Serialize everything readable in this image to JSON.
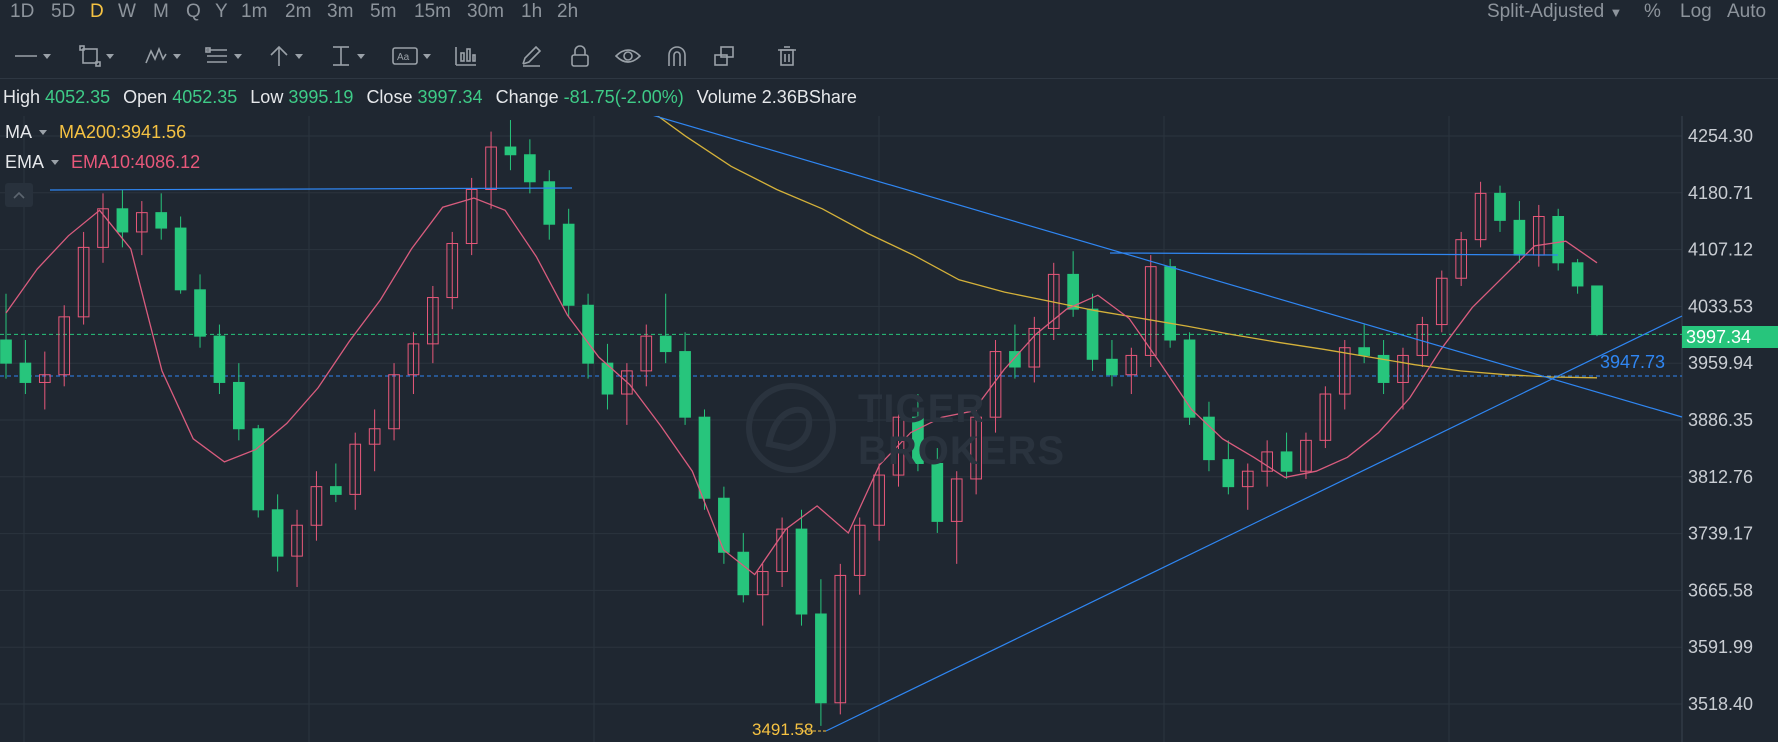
{
  "timeframes": [
    "1D",
    "5D",
    "D",
    "W",
    "M",
    "Q",
    "Y",
    "1m",
    "2m",
    "3m",
    "5m",
    "15m",
    "30m",
    "1h",
    "2h"
  ],
  "active_timeframe": "D",
  "right_options": {
    "adjust": "Split-Adjusted",
    "percent": "%",
    "log": "Log",
    "auto": "Auto"
  },
  "toolbar_icons": [
    "line-tool-icon",
    "rectangle-tool-icon",
    "pattern-tool-icon",
    "fib-tool-icon",
    "arrow-tool-icon",
    "measure-tool-icon",
    "text-tool-icon",
    "indicator-tool-icon",
    "pencil-icon",
    "lock-icon",
    "eye-icon",
    "magnet-icon",
    "copy-icon",
    "trash-icon"
  ],
  "ohlc": {
    "high_label": "High",
    "high": "4052.35",
    "open_label": "Open",
    "open": "4052.35",
    "low_label": "Low",
    "low": "3995.19",
    "close_label": "Close",
    "close": "3997.34",
    "change_label": "Change",
    "change": "-81.75(-2.00%)",
    "volume_label": "Volume",
    "volume": "2.36BShare"
  },
  "indicators": {
    "ma": {
      "name": "MA",
      "value": "MA200:3941.56",
      "color": "#f5c242"
    },
    "ema": {
      "name": "EMA",
      "value": "EMA10:4086.12",
      "color": "#e8587a"
    }
  },
  "watermark": {
    "line1": "TIGER",
    "line2": "BROKERS"
  },
  "last_price_tag": "3997.34",
  "line_price_tag": "3947.73",
  "low_marker": "3491.58",
  "colors": {
    "up": "#e8587a",
    "down": "#27c57c",
    "ma": "#d4b13a",
    "ema": "#d95c7e",
    "trend": "#2f86f2",
    "bg": "#1f2731",
    "grid": "#2b343e"
  },
  "chart_data": {
    "type": "candlestick",
    "y_ticks": [
      "4254.30",
      "4180.71",
      "4107.12",
      "4033.53",
      "3959.94",
      "3886.35",
      "3812.76",
      "3739.17",
      "3665.58",
      "3591.99",
      "3518.40"
    ],
    "ylim": [
      3490,
      4274
    ],
    "last_close": 3997.34,
    "series": [
      {
        "name": "MA200",
        "values": [
          4297,
          4254,
          4215,
          4185,
          4160,
          4128,
          4100,
          4068,
          4052,
          4040,
          4028,
          4018,
          4008,
          3997,
          3987,
          3978,
          3968,
          3958,
          3950,
          3945,
          3942,
          3941
        ]
      },
      {
        "name": "EMA10",
        "values": [
          4025,
          4082,
          4125,
          4158,
          4108,
          3950,
          3862,
          3832,
          3848,
          3882,
          3928,
          3988,
          4042,
          4108,
          4162,
          4174,
          4158,
          4098,
          4022,
          3968,
          3932,
          3878,
          3820,
          3718,
          3686,
          3745,
          3775,
          3740,
          3828,
          3870,
          3890,
          3898,
          3952,
          3997,
          4030,
          4048,
          4018,
          3960,
          3900,
          3862,
          3838,
          3812,
          3820,
          3838,
          3870,
          3915,
          3978,
          4032,
          4072,
          4112,
          4118,
          4090
        ]
      }
    ],
    "candles_ohlc": [
      [
        3990,
        4050,
        3940,
        3960
      ],
      [
        3960,
        3990,
        3920,
        3935
      ],
      [
        3935,
        3975,
        3900,
        3945
      ],
      [
        3945,
        4035,
        3930,
        4020
      ],
      [
        4020,
        4130,
        4010,
        4110
      ],
      [
        4110,
        4180,
        4090,
        4160
      ],
      [
        4160,
        4185,
        4110,
        4130
      ],
      [
        4130,
        4170,
        4100,
        4155
      ],
      [
        4155,
        4180,
        4120,
        4135
      ],
      [
        4135,
        4150,
        4050,
        4055
      ],
      [
        4055,
        4075,
        3980,
        3995
      ],
      [
        3995,
        4010,
        3920,
        3935
      ],
      [
        3935,
        3960,
        3860,
        3875
      ],
      [
        3875,
        3880,
        3760,
        3770
      ],
      [
        3770,
        3790,
        3690,
        3710
      ],
      [
        3710,
        3770,
        3670,
        3750
      ],
      [
        3750,
        3820,
        3730,
        3800
      ],
      [
        3800,
        3830,
        3780,
        3790
      ],
      [
        3790,
        3870,
        3770,
        3855
      ],
      [
        3855,
        3900,
        3820,
        3875
      ],
      [
        3875,
        3960,
        3860,
        3945
      ],
      [
        3945,
        4000,
        3920,
        3985
      ],
      [
        3985,
        4060,
        3960,
        4045
      ],
      [
        4045,
        4130,
        4030,
        4115
      ],
      [
        4115,
        4200,
        4100,
        4185
      ],
      [
        4185,
        4260,
        4160,
        4240
      ],
      [
        4240,
        4275,
        4210,
        4230
      ],
      [
        4230,
        4250,
        4180,
        4195
      ],
      [
        4195,
        4210,
        4120,
        4140
      ],
      [
        4140,
        4160,
        4020,
        4035
      ],
      [
        4035,
        4050,
        3940,
        3960
      ],
      [
        3960,
        3985,
        3900,
        3920
      ],
      [
        3920,
        3960,
        3880,
        3950
      ],
      [
        3950,
        4010,
        3930,
        3995
      ],
      [
        3995,
        4050,
        3960,
        3975
      ],
      [
        3975,
        4000,
        3880,
        3890
      ],
      [
        3890,
        3900,
        3770,
        3785
      ],
      [
        3785,
        3800,
        3700,
        3715
      ],
      [
        3715,
        3740,
        3650,
        3660
      ],
      [
        3660,
        3700,
        3620,
        3690
      ],
      [
        3690,
        3760,
        3670,
        3745
      ],
      [
        3745,
        3770,
        3620,
        3635
      ],
      [
        3635,
        3680,
        3490,
        3520
      ],
      [
        3520,
        3700,
        3505,
        3685
      ],
      [
        3685,
        3760,
        3660,
        3750
      ],
      [
        3750,
        3830,
        3730,
        3815
      ],
      [
        3815,
        3900,
        3800,
        3890
      ],
      [
        3890,
        3920,
        3820,
        3830
      ],
      [
        3830,
        3850,
        3740,
        3755
      ],
      [
        3755,
        3820,
        3700,
        3810
      ],
      [
        3810,
        3900,
        3790,
        3890
      ],
      [
        3890,
        3990,
        3870,
        3975
      ],
      [
        3975,
        4010,
        3940,
        3955
      ],
      [
        3955,
        4020,
        3935,
        4005
      ],
      [
        4005,
        4090,
        3990,
        4075
      ],
      [
        4075,
        4105,
        4020,
        4030
      ],
      [
        4030,
        4050,
        3950,
        3965
      ],
      [
        3965,
        3990,
        3930,
        3945
      ],
      [
        3945,
        3980,
        3920,
        3970
      ],
      [
        3970,
        4100,
        3955,
        4085
      ],
      [
        4085,
        4095,
        3980,
        3990
      ],
      [
        3990,
        4000,
        3880,
        3890
      ],
      [
        3890,
        3910,
        3820,
        3835
      ],
      [
        3835,
        3860,
        3790,
        3800
      ],
      [
        3800,
        3830,
        3770,
        3820
      ],
      [
        3820,
        3860,
        3800,
        3845
      ],
      [
        3845,
        3870,
        3810,
        3820
      ],
      [
        3820,
        3870,
        3810,
        3860
      ],
      [
        3860,
        3930,
        3850,
        3920
      ],
      [
        3920,
        3990,
        3900,
        3980
      ],
      [
        3980,
        4010,
        3960,
        3970
      ],
      [
        3970,
        3990,
        3920,
        3935
      ],
      [
        3935,
        3980,
        3900,
        3970
      ],
      [
        3970,
        4020,
        3955,
        4010
      ],
      [
        4010,
        4080,
        4000,
        4070
      ],
      [
        4070,
        4130,
        4060,
        4120
      ],
      [
        4120,
        4195,
        4110,
        4180
      ],
      [
        4180,
        4190,
        4130,
        4145
      ],
      [
        4145,
        4170,
        4090,
        4100
      ],
      [
        4100,
        4165,
        4085,
        4150
      ],
      [
        4150,
        4160,
        4080,
        4090
      ],
      [
        4090,
        4095,
        4050,
        4060
      ],
      [
        4060,
        4060,
        3995,
        3997
      ]
    ]
  }
}
